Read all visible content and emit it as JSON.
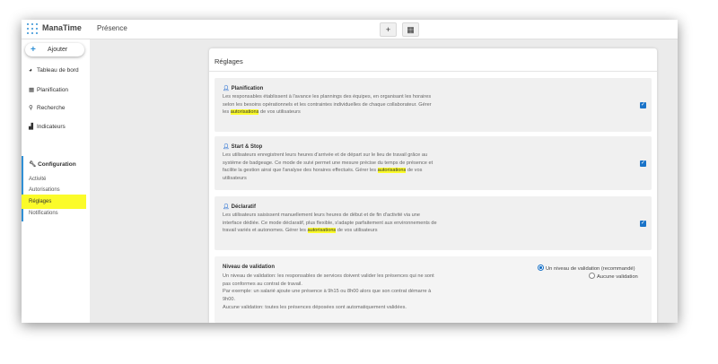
{
  "app": {
    "name": "ManaTime",
    "page_title": "Présence"
  },
  "toolbar": {
    "add_icon_label": "+",
    "calendar_icon_label": "▦"
  },
  "sidebar": {
    "add_label": "Ajouter",
    "items": [
      {
        "label": "Tableau de bord",
        "icon": "dashboard-icon"
      },
      {
        "label": "Planification",
        "icon": "calendar-icon"
      },
      {
        "label": "Recherche",
        "icon": "search-icon"
      },
      {
        "label": "Indicateurs",
        "icon": "chart-icon"
      }
    ],
    "config": {
      "label": "Configuration",
      "subitems": [
        "Activité",
        "Autorisations",
        "Réglages",
        "Notifications"
      ],
      "active": "Réglages"
    }
  },
  "panel": {
    "title": "Réglages",
    "cards": [
      {
        "title": "Planification",
        "desc_before": "Les responsables établissent à l'avance les plannings des équipes, en organisant les horaires selon les besoins opérationnels et les contraintes individuelles de chaque collaborateur. Gérer les ",
        "highlight": "autorisations",
        "desc_after": " de vos utilisateurs",
        "checked": true
      },
      {
        "title": "Start & Stop",
        "desc_before": "Les utilisateurs enregistrent leurs heures d'arrivée et de départ sur le lieu de travail grâce au système de badgeage. Ce mode de suivi permet une mesure précise du temps de présence et facilite la gestion ainsi que l'analyse des horaires effectués. Gérer les ",
        "highlight": "autorisations",
        "desc_after": " de vos utilisateurs",
        "checked": true
      },
      {
        "title": "Déclaratif",
        "desc_before": "Les utilisateurs saisissent manuellement leurs heures de début et de fin d'activité via une interface dédiée. Ce mode déclaratif, plus flexible, s'adapte parfaitement aux environnements de travail variés et autonomes. Gérer les ",
        "highlight": "autorisations",
        "desc_after": " de vos utilisateurs",
        "checked": true
      }
    ],
    "validation": {
      "title": "Niveau de validation",
      "lines": [
        "Un niveau de validation: les responsables de services doivent valider les présences qui ne sont pas conformes au contrat de travail.",
        "Par exemple: un salarié ajoute une présence à 9h15 ou 8h00 alors que son contrat démarre à 9h00.",
        "Aucune validation: toutes les présences déposées sont automatiquement validées."
      ],
      "options": [
        "Un niveau de validation (recommandé)",
        "Aucune validation"
      ],
      "selected": "Un niveau de validation (recommandé)"
    }
  }
}
